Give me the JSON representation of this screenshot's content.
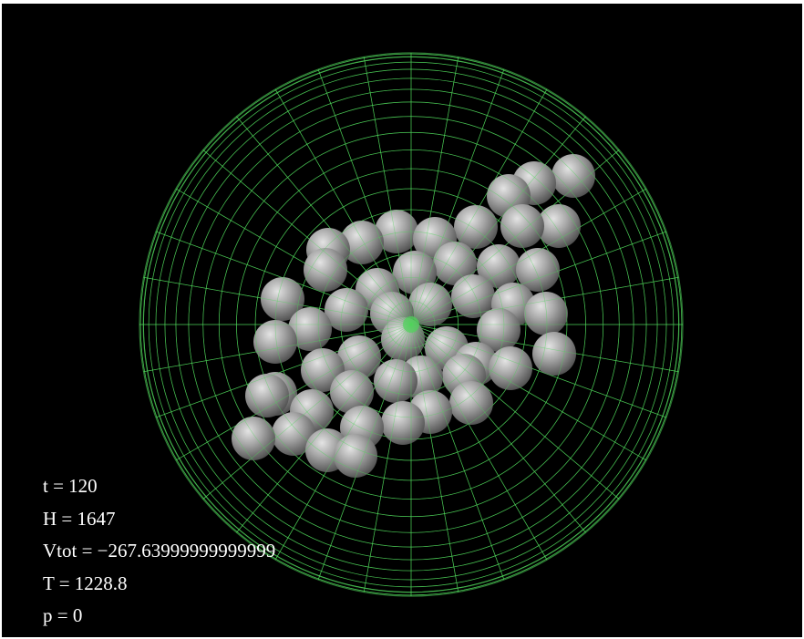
{
  "viewer": {
    "colors": {
      "background": "#000000",
      "wireframe": "#4fd45a",
      "wireframe_outer": "#2f7a35",
      "sphere": "#9c9c9c",
      "text": "#ffffff"
    },
    "wireframe_shape": "sphere",
    "particle_shape": "sphere",
    "readout": {
      "t": "t = 120",
      "H": "H = 1647",
      "Vtot": "Vtot = −267.63999999999999",
      "T": "T = 1228.8",
      "p": "p = 0"
    }
  }
}
